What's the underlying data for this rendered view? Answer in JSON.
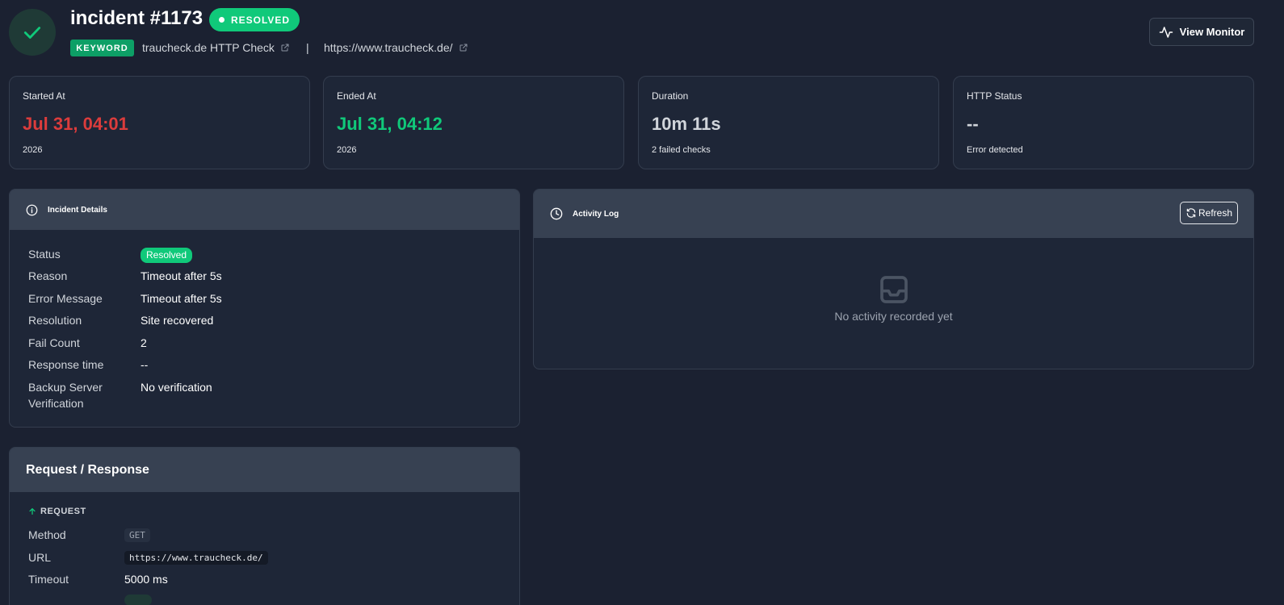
{
  "header": {
    "title": "incident #1173",
    "status_pill": "RESOLVED",
    "type_badge": "KEYWORD",
    "monitor_name": "traucheck.de HTTP Check",
    "separator": "|",
    "monitor_url": "https://www.traucheck.de/",
    "view_monitor_label": "View Monitor"
  },
  "stats": [
    {
      "label": "Started At",
      "value": "Jul 31, 04:01",
      "sub": "2026",
      "color": "#dc3c3c"
    },
    {
      "label": "Ended At",
      "value": "Jul 31, 04:12",
      "sub": "2026",
      "color": "#10c97a"
    },
    {
      "label": "Duration",
      "value": "10m 11s",
      "sub": "2 failed checks",
      "color": "#d1d5db"
    },
    {
      "label": "HTTP Status",
      "value": "--",
      "sub": "Error detected",
      "color": "#d1d5db"
    }
  ],
  "incident_details": {
    "title": "Incident Details",
    "rows": [
      {
        "label": "Status",
        "value": "Resolved"
      },
      {
        "label": "Reason",
        "value": "Timeout after 5s"
      },
      {
        "label": "Error Message",
        "value": "Timeout after 5s"
      },
      {
        "label": "Resolution",
        "value": "Site recovered"
      },
      {
        "label": "Fail Count",
        "value": "2"
      },
      {
        "label": "Response time",
        "value": "--"
      },
      {
        "label": "Backup Server Verification",
        "value": "No verification"
      }
    ]
  },
  "activity_log": {
    "title": "Activity Log",
    "refresh_label": "Refresh",
    "empty_text": "No activity recorded yet"
  },
  "request_response": {
    "title": "Request / Response",
    "request_heading": "REQUEST",
    "rows": [
      {
        "label": "Method",
        "value": "GET"
      },
      {
        "label": "URL",
        "value": "https://www.traucheck.de/"
      },
      {
        "label": "Timeout",
        "value": "5000 ms"
      }
    ]
  },
  "colors": {
    "background": "#1b2131",
    "card": "#1e2637",
    "panel_header": "#374152",
    "success": "#10c97a",
    "danger": "#dc3c3c"
  }
}
